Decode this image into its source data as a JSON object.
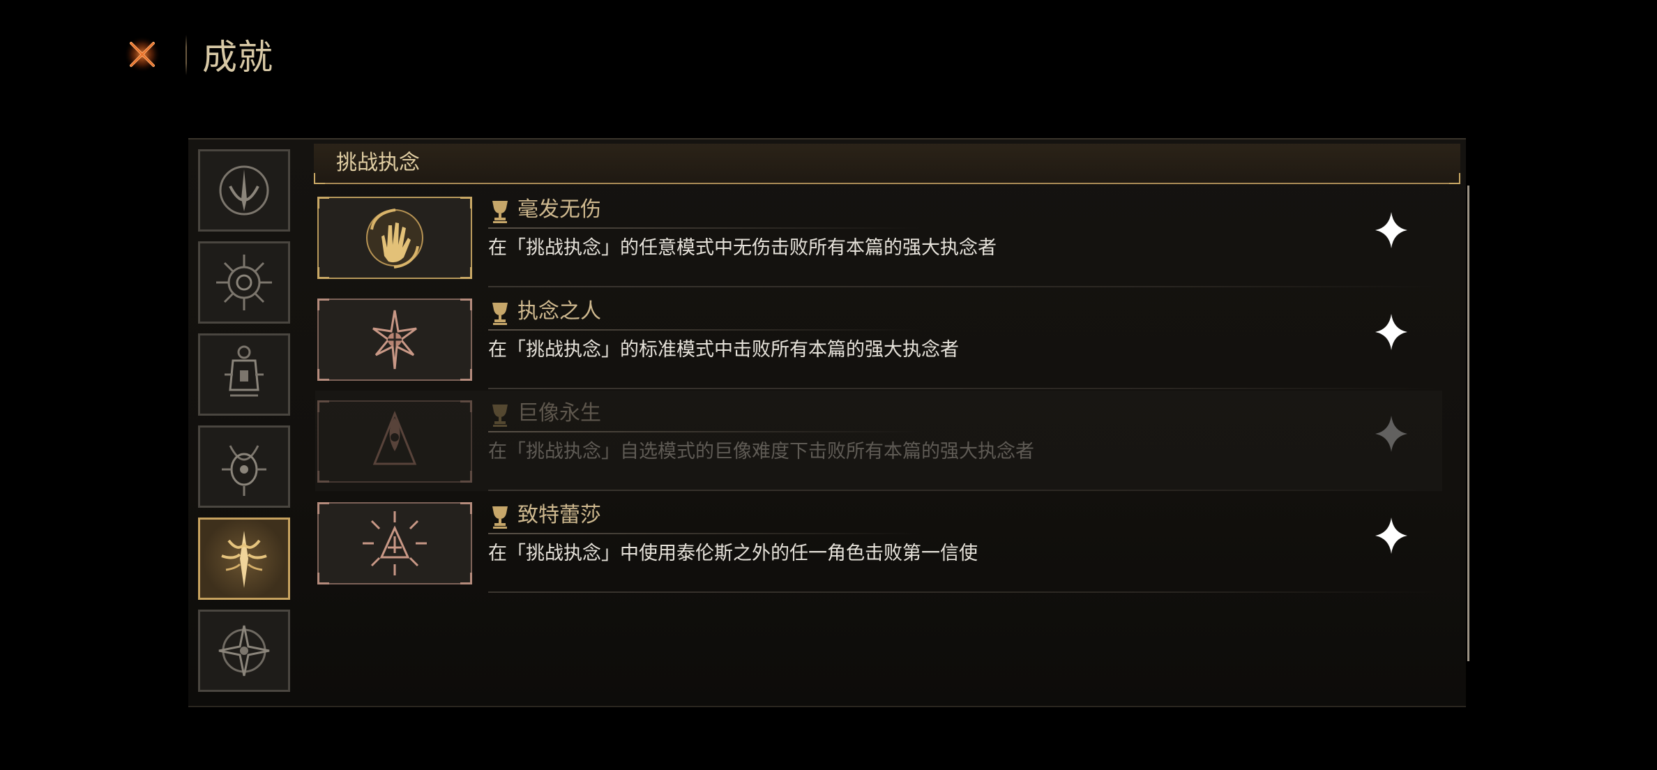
{
  "header": {
    "title": "成就",
    "close_icon": "close-x-icon"
  },
  "sidebar": {
    "tabs": [
      {
        "icon": "crescent-blade-icon",
        "active": false
      },
      {
        "icon": "spiral-sun-icon",
        "active": false
      },
      {
        "icon": "lantern-icon",
        "active": false
      },
      {
        "icon": "horned-eye-icon",
        "active": false
      },
      {
        "icon": "radiant-sword-icon",
        "active": true
      },
      {
        "icon": "star-compass-icon",
        "active": false
      }
    ]
  },
  "section": {
    "title": "挑战执念"
  },
  "achievements": [
    {
      "name": "毫发无伤",
      "description": "在「挑战执念」的任意模式中无伤击败所有本篇的强大执念者",
      "icon": "golden-hand-icon",
      "state": "unlocked-gold"
    },
    {
      "name": "执念之人",
      "description": "在「挑战执念」的标准模式中击败所有本篇的强大执念者",
      "icon": "thorned-sigil-icon",
      "state": "unlocked"
    },
    {
      "name": "巨像永生",
      "description": "在「挑战执念」自选模式的巨像难度下击败所有本篇的强大执念者",
      "icon": "eye-triangle-icon",
      "state": "locked"
    },
    {
      "name": "致特蕾莎",
      "description": "在「挑战执念」中使用泰伦斯之外的任一角色击败第一信使",
      "icon": "burst-triangle-icon",
      "state": "unlocked"
    }
  ],
  "colors": {
    "gold_accent": "#c9a865",
    "title_text": "#d8c9a6",
    "close_orange": "#e8702a"
  }
}
